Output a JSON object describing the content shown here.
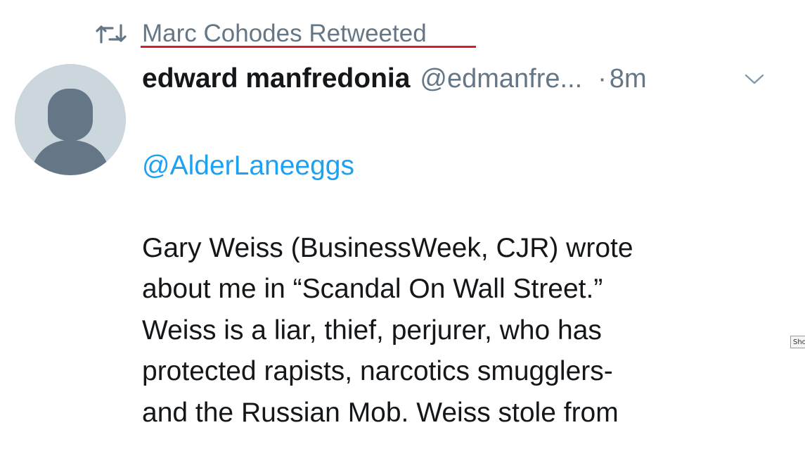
{
  "retweet": {
    "label": "Marc Cohodes Retweeted",
    "icon": "retweet-icon",
    "underline_color": "#d0202a"
  },
  "tweet": {
    "display_name": "edward manfredonia",
    "handle": "@edmanfre...",
    "separator": "·",
    "time": "8m",
    "avatar_icon": "default-avatar-icon",
    "menu_icon": "chevron-down-icon",
    "mention": "@AlderLaneeggs",
    "text": "Gary Weiss (BusinessWeek, CJR) wrote\nabout me in “Scandal On Wall Street.”\nWeiss is a liar, thief, perjurer, who has\nprotected rapists, narcotics smugglers-\nand the Russian Mob.  Weiss stole from"
  },
  "colors": {
    "link_blue": "#1da1f2",
    "secondary_gray": "#657786",
    "text_black": "#14171a",
    "avatar_bg": "#ccd6dd",
    "avatar_fg": "#657786"
  },
  "corner_tag": {
    "label": "Sho"
  }
}
